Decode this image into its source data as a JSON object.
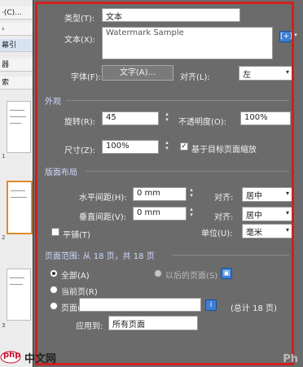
{
  "app_strip": {
    "buttons": [
      "·(C)...",
      "›",
      "幕引",
      "器",
      "索"
    ],
    "thumb_nums": [
      "1",
      "2",
      "3"
    ]
  },
  "dialog": {
    "type_row": {
      "label": "类型(T):",
      "value": "文本"
    },
    "text_row": {
      "label": "文本(X):",
      "value": "Watermark Sample"
    },
    "font_row": {
      "label": "字体(F):",
      "button": "文字(A)...",
      "align_label": "对齐(L):",
      "align_value": "左"
    },
    "appearance": {
      "section": "外观",
      "rotation_label": "旋转(R):",
      "rotation_value": "45",
      "opacity_label": "不透明度(O):",
      "opacity_value": "100%",
      "size_label": "尺寸(Z):",
      "size_value": "100%",
      "relative_label": "基于目标页面缩放"
    },
    "layout": {
      "section": "版面布局",
      "h_spacing_label": "水平间距(H):",
      "h_spacing_value": "0 mm",
      "v_spacing_label": "垂直间距(V):",
      "v_spacing_value": "0 mm",
      "h_align_label": "对齐:",
      "h_align_value": "居中",
      "v_align_label": "对齐:",
      "v_align_value": "居中",
      "units_label": "单位(U):",
      "units_value": "毫米",
      "tile_label": "平铺(T)"
    },
    "page_range": {
      "section": "页面范围: 从 18 页，共 18 页",
      "all_label": "全部(A)",
      "current_label": "当前页(R)",
      "pages_label": "页面(G)",
      "pages_note": "(总计 18 页)",
      "selected_label": "以后的页面(S)",
      "apply_label": "应用到:",
      "apply_value": "所有页面"
    }
  },
  "watermark": {
    "site": "中文网",
    "logo_text": "php"
  },
  "site_watermark": "Ph"
}
